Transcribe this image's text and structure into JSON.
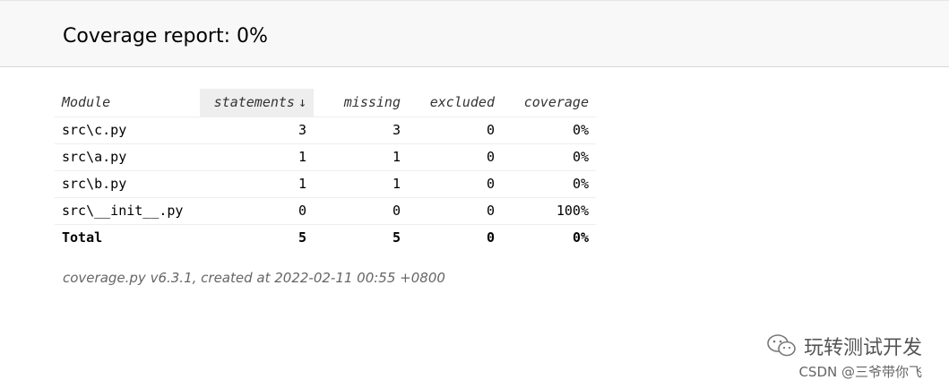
{
  "header": {
    "title": "Coverage report: 0%"
  },
  "table": {
    "columns": {
      "module": "Module",
      "statements": "statements",
      "sort_arrow": "↓",
      "missing": "missing",
      "excluded": "excluded",
      "coverage": "coverage"
    },
    "rows": [
      {
        "module": "src\\c.py",
        "statements": "3",
        "missing": "3",
        "excluded": "0",
        "coverage": "0%"
      },
      {
        "module": "src\\a.py",
        "statements": "1",
        "missing": "1",
        "excluded": "0",
        "coverage": "0%"
      },
      {
        "module": "src\\b.py",
        "statements": "1",
        "missing": "1",
        "excluded": "0",
        "coverage": "0%"
      },
      {
        "module": "src\\__init__.py",
        "statements": "0",
        "missing": "0",
        "excluded": "0",
        "coverage": "100%"
      }
    ],
    "total": {
      "module": "Total",
      "statements": "5",
      "missing": "5",
      "excluded": "0",
      "coverage": "0%"
    }
  },
  "footer": {
    "text": "coverage.py v6.3.1, created at 2022-02-11 00:55 +0800"
  },
  "watermark": {
    "line1": "玩转测试开发",
    "line2": "CSDN @三爷带你飞",
    "icon": "wechat-icon"
  }
}
